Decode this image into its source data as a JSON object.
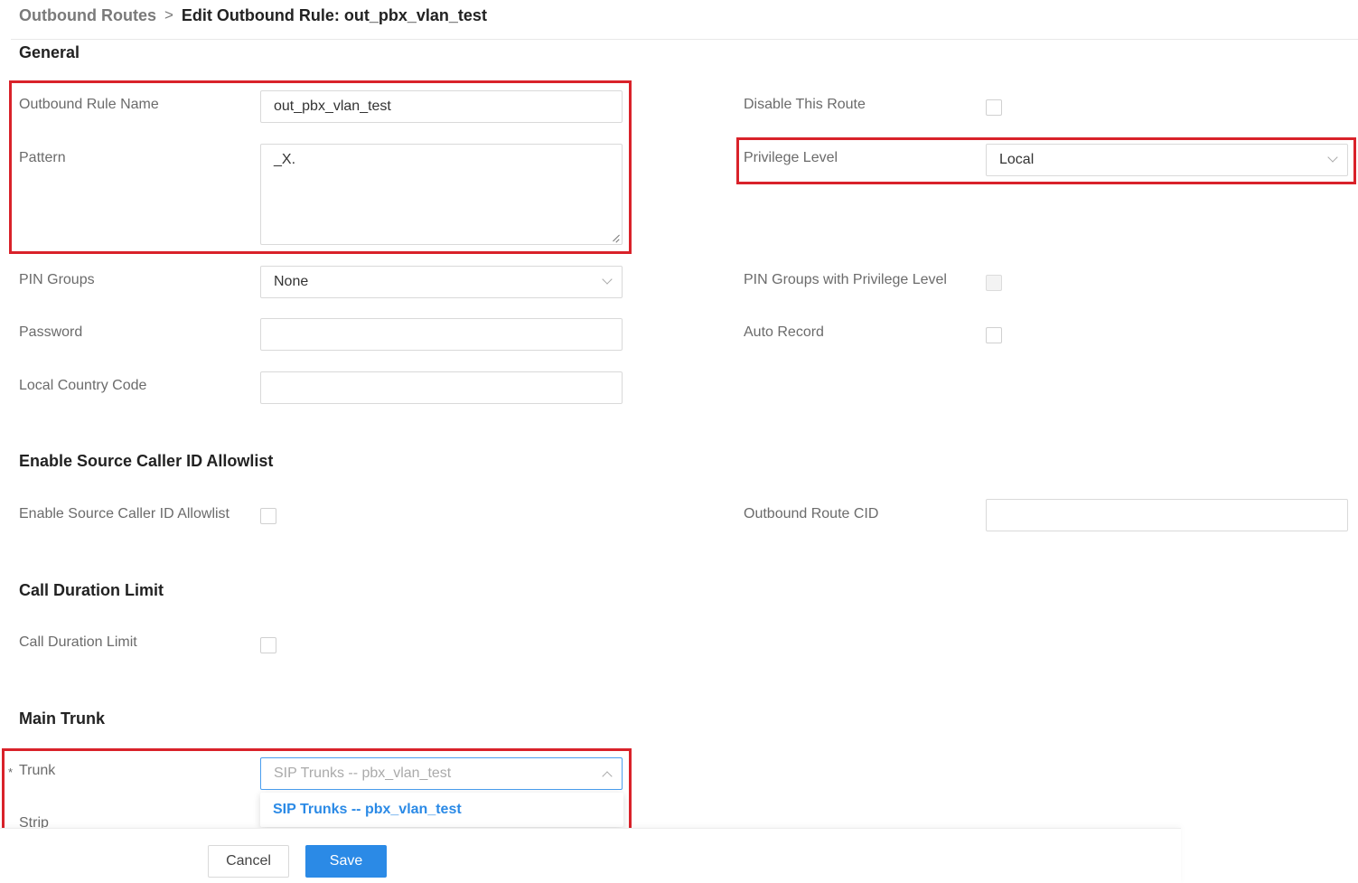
{
  "breadcrumb": {
    "parent": "Outbound Routes",
    "separator": ">",
    "current": "Edit Outbound Rule: out_pbx_vlan_test"
  },
  "sections": {
    "general": "General",
    "allowlist": "Enable Source Caller ID Allowlist",
    "duration": "Call Duration Limit",
    "main_trunk": "Main Trunk"
  },
  "general": {
    "rule_name": {
      "label": "Outbound Rule Name",
      "value": "out_pbx_vlan_test"
    },
    "pattern": {
      "label": "Pattern",
      "value": "_X."
    },
    "pin_groups": {
      "label": "PIN Groups",
      "value": "None"
    },
    "password": {
      "label": "Password",
      "value": ""
    },
    "local_country_code": {
      "label": "Local Country Code",
      "value": ""
    },
    "disable_route": {
      "label": "Disable This Route",
      "checked": false
    },
    "privilege_level": {
      "label": "Privilege Level",
      "value": "Local"
    },
    "pin_groups_privilege": {
      "label": "PIN Groups with Privilege Level",
      "checked": false,
      "disabled": true
    },
    "auto_record": {
      "label": "Auto Record",
      "checked": false
    }
  },
  "allowlist": {
    "enable": {
      "label": "Enable Source Caller ID Allowlist",
      "checked": false
    },
    "route_cid": {
      "label": "Outbound Route CID",
      "value": ""
    }
  },
  "duration": {
    "enable": {
      "label": "Call Duration Limit",
      "checked": false
    }
  },
  "main_trunk": {
    "trunk": {
      "required_marker": "*",
      "label": "Trunk",
      "placeholder": "SIP Trunks -- pbx_vlan_test",
      "options": [
        "SIP Trunks -- pbx_vlan_test"
      ]
    },
    "strip": {
      "label": "Strip"
    }
  },
  "footer": {
    "cancel": "Cancel",
    "save": "Save"
  },
  "colors": {
    "highlight": "#d9222a",
    "primary": "#2b8ae6"
  },
  "icons": {
    "select_closed": "chevron-down-icon",
    "select_open": "chevron-up-icon",
    "textarea_resize": "resize-grip-icon"
  }
}
